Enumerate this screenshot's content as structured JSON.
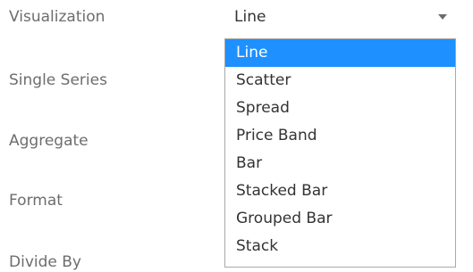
{
  "form": {
    "labels": [
      "Visualization",
      "Single Series",
      "Aggregate",
      "Format",
      "Divide By"
    ]
  },
  "visualization_select": {
    "value": "Line",
    "arrow_icon": "caret-down-icon"
  },
  "dropdown": {
    "selected_index": 0,
    "selected_color": "#1e90ff",
    "options": [
      "Line",
      "Scatter",
      "Spread",
      "Price Band",
      "Bar",
      "Stacked Bar",
      "Grouped Bar",
      "Stack"
    ]
  }
}
